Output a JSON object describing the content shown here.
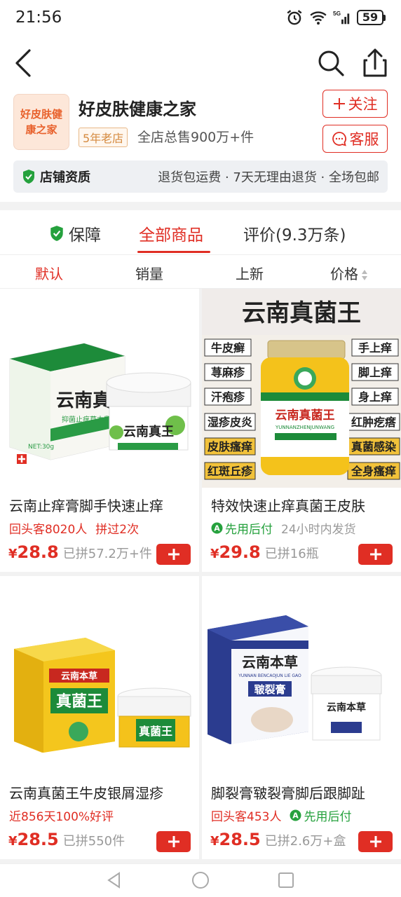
{
  "status": {
    "time": "21:56",
    "battery": "59",
    "network": "5G"
  },
  "nav": {},
  "store": {
    "logo_text": "好皮肤健康之家",
    "name": "好皮肤健康之家",
    "age_badge": "5年老店",
    "sales": "全店总售900万+件",
    "follow_label": "关注",
    "service_label": "客服",
    "qualification_label": "店铺资质",
    "policy": "退货包运费 · 7天无理由退货 · 全场包邮"
  },
  "tabs": [
    {
      "label": "保障"
    },
    {
      "label": "全部商品"
    },
    {
      "label": "评价(9.3万条)"
    }
  ],
  "sort": [
    {
      "label": "默认"
    },
    {
      "label": "销量"
    },
    {
      "label": "上新"
    },
    {
      "label": "价格"
    }
  ],
  "products": [
    {
      "title": "云南止痒膏脚手快速止痒",
      "tag1": "回头客8020人",
      "tag2": "拼过2次",
      "price_symbol": "¥",
      "price": "28.8",
      "sold": "已拼57.2万+件",
      "image": {
        "box_brand": "云南真",
        "box_sub": "抑菌止痒草本乳",
        "jar_text": "云南真王",
        "spec": "NET:30g"
      }
    },
    {
      "title": "特效快速止痒真菌王皮肤",
      "tag1": "先用后付",
      "tag2": "24小时内发货",
      "price_symbol": "¥",
      "price": "29.8",
      "sold": "已拼16瓶",
      "image": {
        "banner": "云南真菌王",
        "left_labels": [
          "牛皮癣",
          "荨麻疹",
          "汗疱疹",
          "湿疹皮炎",
          "皮肤瘙痒",
          "红斑丘疹"
        ],
        "right_labels": [
          "手上痒",
          "脚上痒",
          "身上痒",
          "红肿疙瘩",
          "真菌感染",
          "全身瘙痒"
        ],
        "jar_text": "云南真菌王",
        "jar_pinyin": "YUNNANZHENJUNWANG"
      }
    },
    {
      "title": "云南真菌王牛皮银屑湿疹",
      "tag1": "近856天100%好评",
      "tag2": "",
      "price_symbol": "¥",
      "price": "28.5",
      "sold": "已拼550件",
      "image": {
        "box_top": "云南本草",
        "box_main": "真菌王",
        "jar_text": "真菌王"
      }
    },
    {
      "title": "脚裂膏皲裂膏脚后跟脚趾",
      "tag1": "回头客453人",
      "tag2": "先用后付",
      "price_symbol": "¥",
      "price": "28.5",
      "sold": "已拼2.6万+盒",
      "image": {
        "box_top": "云南本草",
        "box_main": "皲裂膏",
        "box_pinyin": "YUNNAN BENCAOJUN LIE GAO",
        "jar_text": "云南本草"
      }
    }
  ],
  "colors": {
    "accent": "#e02e24",
    "green": "#25a13d",
    "store_logo_bg": "#fde7d9"
  }
}
